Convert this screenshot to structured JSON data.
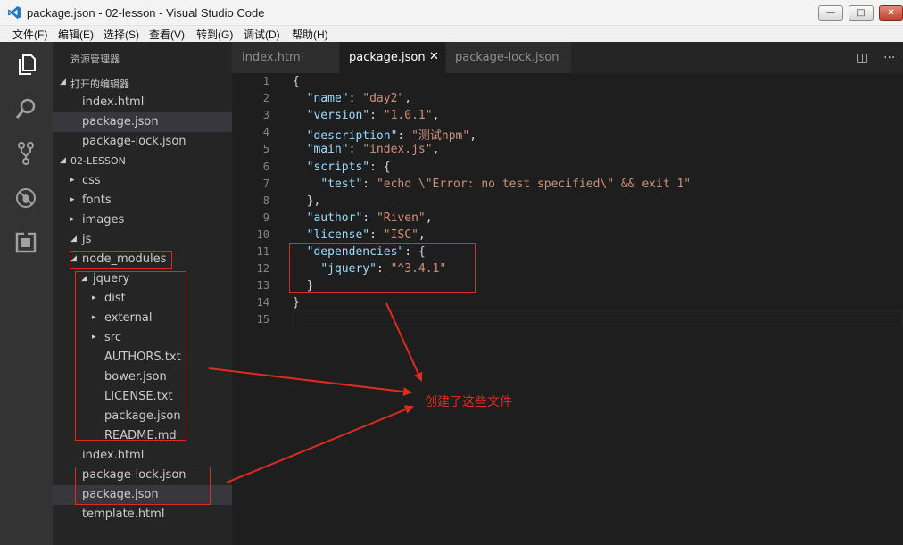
{
  "window": {
    "title": "package.json - 02-lesson - Visual Studio Code",
    "min_glyph": "—",
    "max_glyph": "□",
    "close_glyph": "✕"
  },
  "menu": [
    "文件(F)",
    "编辑(E)",
    "选择(S)",
    "查看(V)",
    "转到(G)",
    "调试(D)",
    "帮助(H)"
  ],
  "activity_icons": [
    "explorer-icon",
    "search-icon",
    "source-control-icon",
    "debug-icon",
    "extensions-icon"
  ],
  "sidebar": {
    "header": "资源管理器",
    "open_editors": {
      "label": "打开的编辑器",
      "items": [
        "index.html",
        "package.json",
        "package-lock.json"
      ]
    },
    "folder": {
      "label": "02-LESSON",
      "items": [
        {
          "label": "css",
          "twisty": "▸"
        },
        {
          "label": "fonts",
          "twisty": "▸"
        },
        {
          "label": "images",
          "twisty": "▸"
        },
        {
          "label": "js",
          "twisty": "◢"
        },
        {
          "label": "node_modules",
          "twisty": "◢"
        },
        {
          "label": "jquery",
          "twisty": "◢"
        },
        {
          "label": "dist",
          "twisty": "▸"
        },
        {
          "label": "external",
          "twisty": "▸"
        },
        {
          "label": "src",
          "twisty": "▸"
        },
        {
          "label": "AUTHORS.txt",
          "twisty": ""
        },
        {
          "label": "bower.json",
          "twisty": ""
        },
        {
          "label": "LICENSE.txt",
          "twisty": ""
        },
        {
          "label": "package.json",
          "twisty": ""
        },
        {
          "label": "README.md",
          "twisty": ""
        },
        {
          "label": "index.html",
          "twisty": ""
        },
        {
          "label": "package-lock.json",
          "twisty": ""
        },
        {
          "label": "package.json",
          "twisty": ""
        },
        {
          "label": "template.html",
          "twisty": ""
        }
      ]
    },
    "twisty_open": "◢"
  },
  "tabs": [
    {
      "label": "index.html"
    },
    {
      "label": "package.json",
      "close": "✕"
    },
    {
      "label": "package-lock.json"
    }
  ],
  "tab_actions": {
    "split": "◫",
    "more": "···"
  },
  "editor": {
    "line_numbers": [
      "1",
      "2",
      "3",
      "4",
      "5",
      "6",
      "7",
      "8",
      "9",
      "10",
      "11",
      "12",
      "13",
      "14",
      "15"
    ],
    "lines": [
      [
        {
          "t": "{",
          "c": "p"
        }
      ],
      [
        {
          "t": "  ",
          "c": "p"
        },
        {
          "t": "\"name\"",
          "c": "k"
        },
        {
          "t": ": ",
          "c": "p"
        },
        {
          "t": "\"day2\"",
          "c": "s"
        },
        {
          "t": ",",
          "c": "p"
        }
      ],
      [
        {
          "t": "  ",
          "c": "p"
        },
        {
          "t": "\"version\"",
          "c": "k"
        },
        {
          "t": ": ",
          "c": "p"
        },
        {
          "t": "\"1.0.1\"",
          "c": "s"
        },
        {
          "t": ",",
          "c": "p"
        }
      ],
      [
        {
          "t": "  ",
          "c": "p"
        },
        {
          "t": "\"description\"",
          "c": "k"
        },
        {
          "t": ": ",
          "c": "p"
        },
        {
          "t": "\"测试npm\"",
          "c": "s"
        },
        {
          "t": ",",
          "c": "p"
        }
      ],
      [
        {
          "t": "  ",
          "c": "p"
        },
        {
          "t": "\"main\"",
          "c": "k"
        },
        {
          "t": ": ",
          "c": "p"
        },
        {
          "t": "\"index.js\"",
          "c": "s"
        },
        {
          "t": ",",
          "c": "p"
        }
      ],
      [
        {
          "t": "  ",
          "c": "p"
        },
        {
          "t": "\"scripts\"",
          "c": "k"
        },
        {
          "t": ": {",
          "c": "p"
        }
      ],
      [
        {
          "t": "    ",
          "c": "p"
        },
        {
          "t": "\"test\"",
          "c": "k"
        },
        {
          "t": ": ",
          "c": "p"
        },
        {
          "t": "\"echo \\\"Error: no test specified\\\" && exit 1\"",
          "c": "s"
        }
      ],
      [
        {
          "t": "  },",
          "c": "p"
        }
      ],
      [
        {
          "t": "  ",
          "c": "p"
        },
        {
          "t": "\"author\"",
          "c": "k"
        },
        {
          "t": ": ",
          "c": "p"
        },
        {
          "t": "\"Riven\"",
          "c": "s"
        },
        {
          "t": ",",
          "c": "p"
        }
      ],
      [
        {
          "t": "  ",
          "c": "p"
        },
        {
          "t": "\"license\"",
          "c": "k"
        },
        {
          "t": ": ",
          "c": "p"
        },
        {
          "t": "\"ISC\"",
          "c": "s"
        },
        {
          "t": ",",
          "c": "p"
        }
      ],
      [
        {
          "t": "  ",
          "c": "p"
        },
        {
          "t": "\"dependencies\"",
          "c": "k"
        },
        {
          "t": ": {",
          "c": "p"
        }
      ],
      [
        {
          "t": "    ",
          "c": "p"
        },
        {
          "t": "\"jquery\"",
          "c": "k"
        },
        {
          "t": ": ",
          "c": "p"
        },
        {
          "t": "\"^3.4.1\"",
          "c": "s"
        }
      ],
      [
        {
          "t": "  }",
          "c": "p"
        }
      ],
      [
        {
          "t": "}",
          "c": "p"
        }
      ],
      []
    ]
  },
  "annotation": {
    "text": "创建了这些文件",
    "color": "#e02a1f"
  },
  "colors": {
    "accent": "#007acc",
    "annotation_red": "#e02a1f",
    "json_key": "#9cdcfe",
    "json_string": "#ce9178"
  }
}
